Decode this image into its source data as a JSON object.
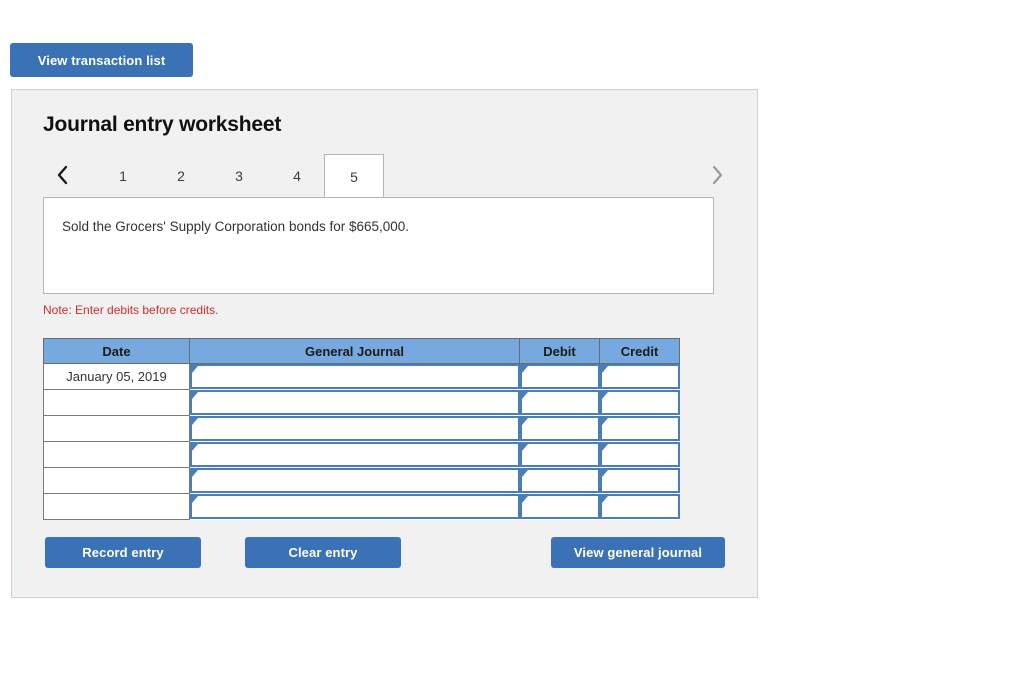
{
  "toolbar": {
    "view_transaction_list_label": "View transaction list"
  },
  "panel": {
    "title": "Journal entry worksheet",
    "note": "Note: Enter debits before credits."
  },
  "tabs": {
    "prev_icon": "chevron-left-icon",
    "next_icon": "chevron-right-icon",
    "items": [
      {
        "label": "1",
        "active": false
      },
      {
        "label": "2",
        "active": false
      },
      {
        "label": "3",
        "active": false
      },
      {
        "label": "4",
        "active": false
      },
      {
        "label": "5",
        "active": true
      }
    ]
  },
  "transaction": {
    "description": "Sold the Grocers' Supply Corporation bonds for $665,000."
  },
  "journal": {
    "columns": [
      "Date",
      "General Journal",
      "Debit",
      "Credit"
    ],
    "rows": [
      {
        "date": "January 05, 2019",
        "journal": "",
        "debit": "",
        "credit": ""
      },
      {
        "date": "",
        "journal": "",
        "debit": "",
        "credit": ""
      },
      {
        "date": "",
        "journal": "",
        "debit": "",
        "credit": ""
      },
      {
        "date": "",
        "journal": "",
        "debit": "",
        "credit": ""
      },
      {
        "date": "",
        "journal": "",
        "debit": "",
        "credit": ""
      },
      {
        "date": "",
        "journal": "",
        "debit": "",
        "credit": ""
      }
    ]
  },
  "actions": {
    "record_entry_label": "Record entry",
    "clear_entry_label": "Clear entry",
    "view_general_journal_label": "View general journal"
  },
  "colors": {
    "button_blue": "#3b72b5",
    "table_header_blue": "#76a9e0",
    "input_border_blue": "#4a7fb5",
    "note_red": "#c9302c",
    "panel_bg": "#f1f1f1"
  }
}
